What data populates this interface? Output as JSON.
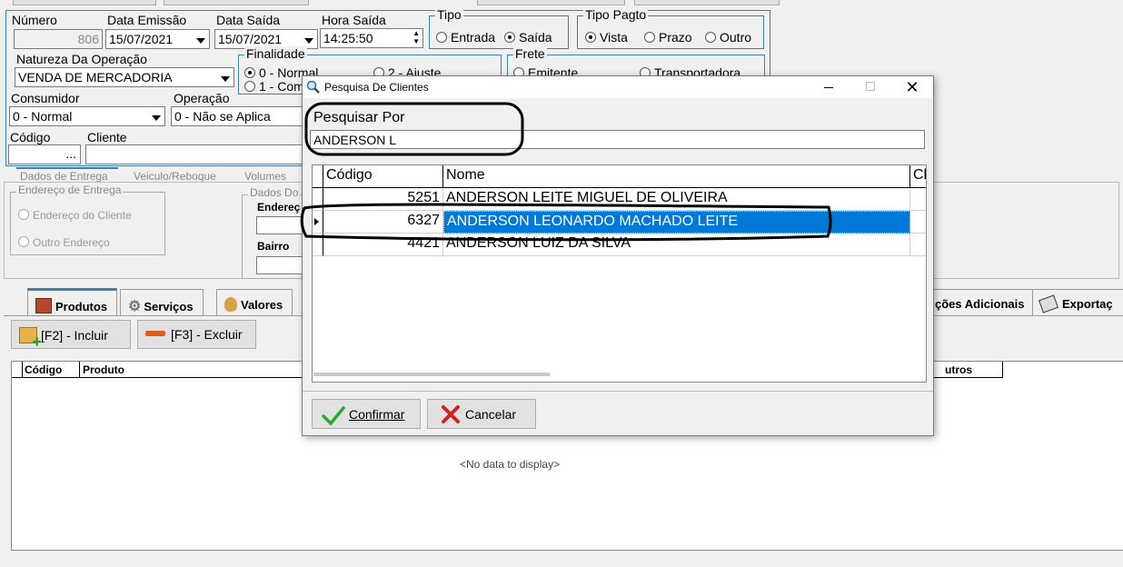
{
  "form": {
    "numero": {
      "label": "Número",
      "value": "806"
    },
    "data_emissao": {
      "label": "Data Emissão",
      "value": "15/07/2021"
    },
    "data_saida": {
      "label": "Data Saída",
      "value": "15/07/2021"
    },
    "hora_saida": {
      "label": "Hora Saída",
      "value": "14:25:50"
    },
    "tipo": {
      "legend": "Tipo",
      "options": [
        "Entrada",
        "Saída"
      ],
      "selected": "Saída"
    },
    "tipo_pagto": {
      "legend": "Tipo Pagto",
      "options": [
        "Vista",
        "Prazo",
        "Outro"
      ],
      "selected": "Vista"
    },
    "natureza": {
      "label": "Natureza Da Operação",
      "value": "VENDA DE MERCADORIA"
    },
    "finalidade": {
      "legend": "Finalidade",
      "options": [
        "0 - Normal",
        "2 - Ajuste",
        "1 - Com"
      ],
      "selected": "0 - Normal"
    },
    "frete": {
      "legend": "Frete",
      "options": [
        "Emitente",
        "Transportadora"
      ]
    },
    "consumidor": {
      "label": "Consumidor",
      "value": "0 - Normal"
    },
    "operacao": {
      "label": "Operação",
      "value": "0 - Não se Aplica"
    },
    "codigo": {
      "label": "Código",
      "button": "..."
    },
    "cliente": {
      "label": "Cliente"
    }
  },
  "entrega_tabs": [
    "Dados de Entrega",
    "Veiculo/Reboque",
    "Volumes"
  ],
  "endereco_entrega": {
    "legend": "Endereço de Entrega",
    "options": [
      "Endereço do Cliente",
      "Outro Endereço"
    ]
  },
  "dados_do": {
    "legend": "Dados Do",
    "endereco_label": "Endereç",
    "bairro_label": "Bairro"
  },
  "bottom_tabs": {
    "produtos": "Produtos",
    "servicos": "Serviços",
    "valores": "Valores",
    "informacoes": "ções Adicionais",
    "exportacao": "Exportaç"
  },
  "toolbar": {
    "incluir": "[F2] - Incluir",
    "excluir": "[F3] - Excluir"
  },
  "products_grid": {
    "col_codigo": "Código",
    "col_produto": "Produto",
    "col_outros": "utros",
    "empty": "<No data to display>"
  },
  "dialog": {
    "title": "Pesquisa De Clientes",
    "search_label": "Pesquisar Por",
    "search_value": "ANDERSON L",
    "columns": [
      "Código",
      "Nome",
      "Cl"
    ],
    "rows": [
      {
        "codigo": "5251",
        "nome": "ANDERSON LEITE MIGUEL DE OLIVEIRA"
      },
      {
        "codigo": "6327",
        "nome": "ANDERSON LEONARDO MACHADO LEITE"
      },
      {
        "codigo": "4421",
        "nome": "ANDERSON LUIZ DA SILVA"
      }
    ],
    "selected_row": 1,
    "confirm": "Confirmar",
    "cancel": "Cancelar"
  },
  "colors": {
    "accent": "#3c7fb1",
    "selection": "#0078d7"
  }
}
